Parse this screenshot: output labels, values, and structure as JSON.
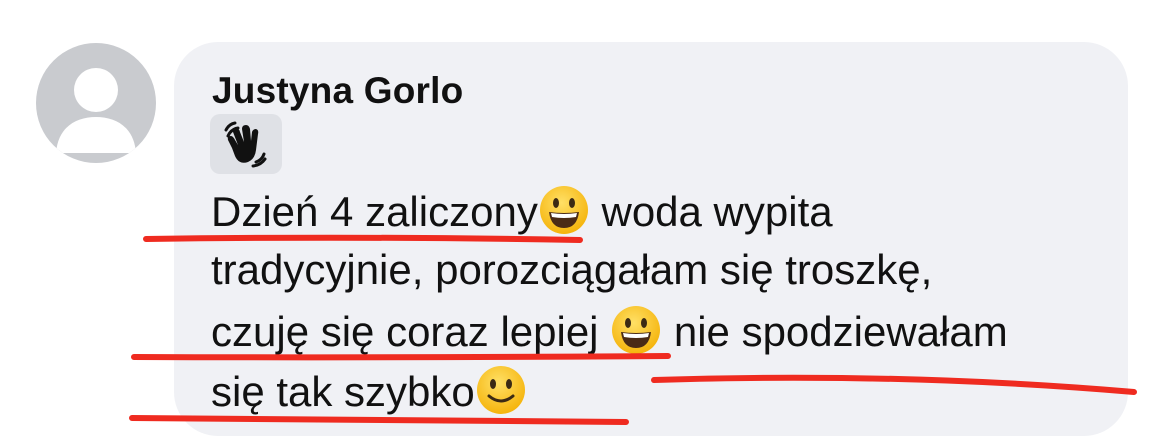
{
  "comment": {
    "author": "Justyna Gorlo",
    "reaction_icon": "waving-hand-icon",
    "lines": [
      {
        "text_before": "Dzień 4 zaliczony",
        "emoji": "grinning-face-icon",
        "text_after": " woda wypita"
      },
      {
        "text": "tradycyjnie, porozciągałam się troszkę,"
      },
      {
        "text_before": "czuję się coraz lepiej ",
        "emoji": "grinning-face-icon",
        "text_after": " nie spodziewałam"
      },
      {
        "text_before": "się tak szybko",
        "emoji": "slightly-smiling-face-icon"
      }
    ]
  },
  "colors": {
    "bubble": "#f0f1f5",
    "avatar": "#c9cbcf",
    "underline": "#ef2b20",
    "text": "#111111"
  }
}
